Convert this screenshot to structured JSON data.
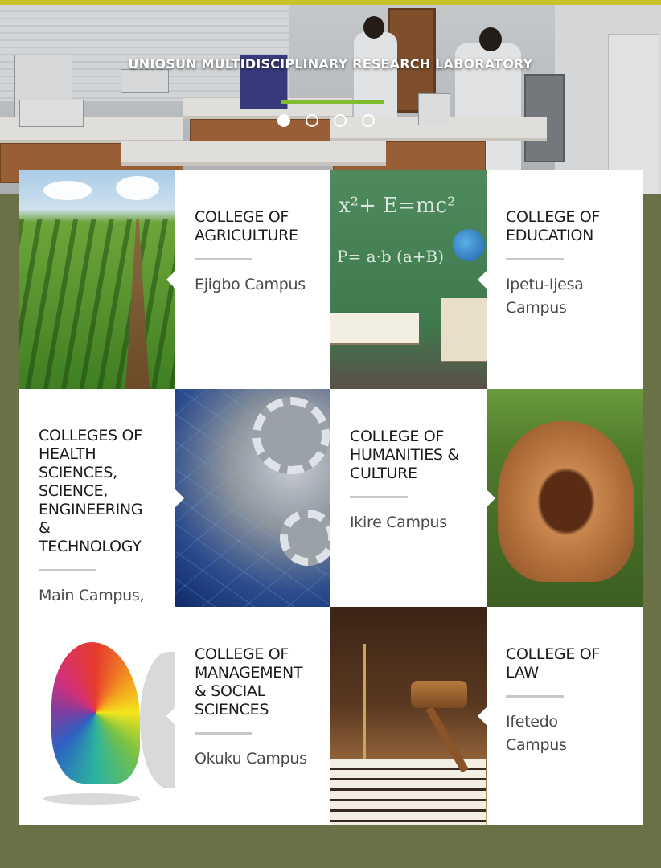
{
  "hero": {
    "caption": "UNIOSUN MULTIDISCIPLINARY RESEARCH LABORATORY",
    "slide_count": 4,
    "active_slide": 1
  },
  "colleges": [
    {
      "title": "COLLEGE OF\nAGRICULTURE",
      "campus": "Ejigbo Campus",
      "image": "crop-field-image"
    },
    {
      "title": "COLLEGE OF\nEDUCATION",
      "campus": "Ipetu-Ijesa\nCampus",
      "image": "chalkboard-books-image"
    },
    {
      "title": "COLLEGES OF\nHEALTH\nSCIENCES,\nSCIENCE,\nENGINEERING\n&\nTECHNOLOGY",
      "campus": "Main Campus,\nOsogbo",
      "image": "gears-microscope-image"
    },
    {
      "title": "COLLEGE OF\nHUMANITIES &\nCULTURE",
      "campus": "Ikire Campus",
      "image": "carved-rock-shrine-image"
    },
    {
      "title": "COLLEGE OF\nMANAGEMENT\n& SOCIAL\nSCIENCES",
      "campus": "Okuku Campus",
      "image": "colorful-mind-image"
    },
    {
      "title": "COLLEGE OF\nLAW",
      "campus": "Ifetedo\nCampus",
      "image": "gavel-scales-image"
    }
  ],
  "colors": {
    "background": "#6a7146",
    "top_bar": "#c9c22a",
    "hero_accent": "#7fbc2e",
    "card": "#ffffff",
    "divider": "#c8c8c8"
  }
}
